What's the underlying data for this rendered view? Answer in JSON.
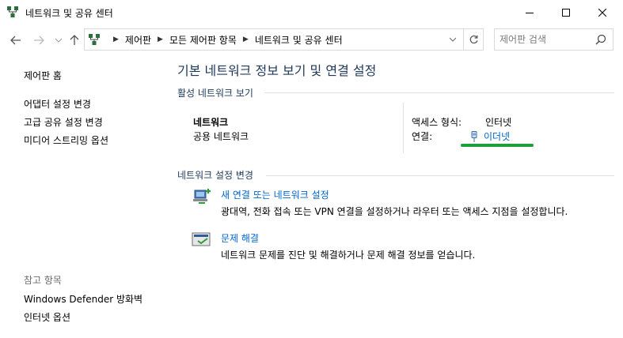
{
  "window": {
    "title": "네트워크 및 공유 센터"
  },
  "address": {
    "crumbs": [
      "제어판",
      "모든 제어판 항목",
      "네트워크 및 공유 센터"
    ],
    "search_placeholder": "제어판 검색"
  },
  "sidebar": {
    "home": "제어판 홈",
    "items": [
      "어댑터 설정 변경",
      "고급 공유 설정 변경",
      "미디어 스트리밍 옵션"
    ],
    "see_also_header": "참고 항목",
    "see_also": [
      "Windows Defender 방화벽",
      "인터넷 옵션"
    ]
  },
  "main": {
    "title": "기본 네트워크 정보 보기 및 연결 설정",
    "active_networks_header": "활성 네트워크 보기",
    "network_name": "네트워크",
    "network_type": "공용 네트워크",
    "access_type_label": "액세스 형식:",
    "access_type_value": "인터넷",
    "connections_label": "연결:",
    "connections_value": "이더넷",
    "change_settings_header": "네트워크 설정 변경",
    "tasks": [
      {
        "link": "새 연결 또는 네트워크 설정",
        "desc": "광대역, 전화 접속 또는 VPN 연결을 설정하거나 라우터 또는 액세스 지점을 설정합니다."
      },
      {
        "link": "문제 해결",
        "desc": "네트워크 문제를 진단 및 해결하거나 문제 해결 정보를 얻습니다."
      }
    ]
  },
  "colors": {
    "link": "#0066cc",
    "heading": "#1e395b",
    "annotation": "#1e9e3b"
  }
}
